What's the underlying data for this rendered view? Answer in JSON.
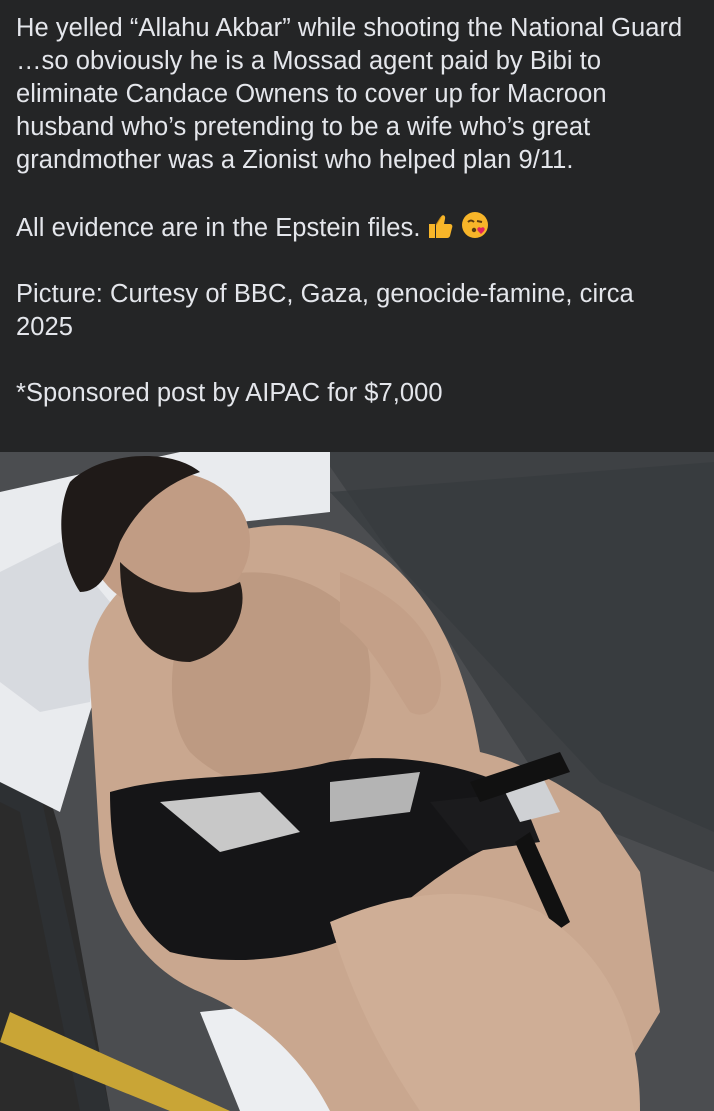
{
  "post": {
    "paragraph_1": "He yelled “Allahu Akbar” while shooting the National Guard …so obviously he is a Mossad agent paid by Bibi to eliminate Candace Ownens to cover up for Macroon husband who’s pretending to be a wife who’s great grandmother was a Zionist who helped plan 9/11.",
    "paragraph_2": "All evidence are in the Epstein files.",
    "paragraph_2_emojis": [
      "thumbs-up-icon",
      "face-blowing-kiss-icon"
    ],
    "paragraph_3": "Picture: Curtesy of BBC, Gaza, genocide-famine, circa 2025",
    "paragraph_4": "*Sponsored post by AIPAC for $7,000"
  },
  "photo": {
    "subject": "shirtless bearded man lying on a stretcher",
    "icon": "photo-icon"
  },
  "colors": {
    "background": "#242526",
    "text": "#e4e6eb",
    "emoji_yellow": "#f7b529"
  }
}
